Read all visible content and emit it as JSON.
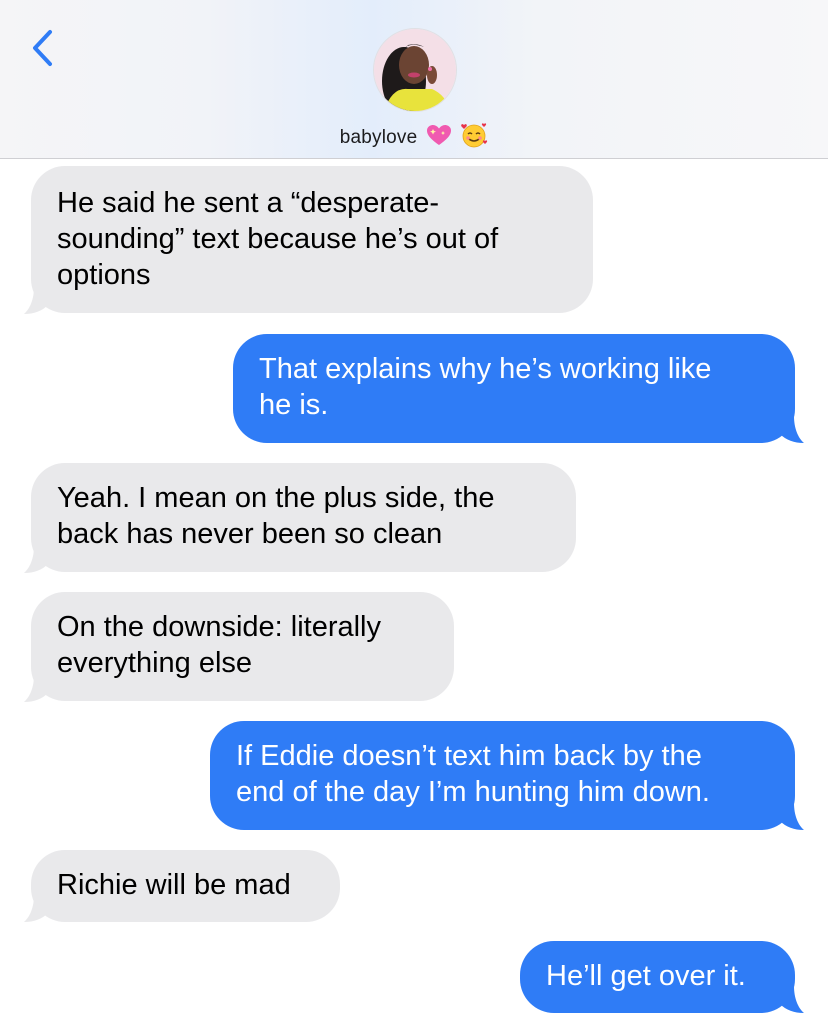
{
  "header": {
    "contact_name": "babylove",
    "back_icon": "chevron-left-icon",
    "emojis": [
      "sparkling-heart-icon",
      "smiling-face-with-hearts-icon"
    ]
  },
  "colors": {
    "incoming_bubble": "#e9e9eb",
    "outgoing_bubble": "#2f7cf6",
    "accent": "#2f7cf6"
  },
  "messages": [
    {
      "direction": "incoming",
      "text": "He said he sent a “desperate-\nsounding” text because he’s out of\noptions"
    },
    {
      "direction": "outgoing",
      "text": "That explains why he’s working like\nhe is."
    },
    {
      "direction": "incoming",
      "text": "Yeah. I mean on the plus side, the\nback has never been so clean"
    },
    {
      "direction": "incoming",
      "text": "On the downside: literally\neverything else"
    },
    {
      "direction": "outgoing",
      "text": "If Eddie doesn’t text him back by the\nend of the day I’m hunting him down."
    },
    {
      "direction": "incoming",
      "text": "Richie will be mad"
    },
    {
      "direction": "outgoing",
      "text": "He’ll get over it."
    }
  ]
}
